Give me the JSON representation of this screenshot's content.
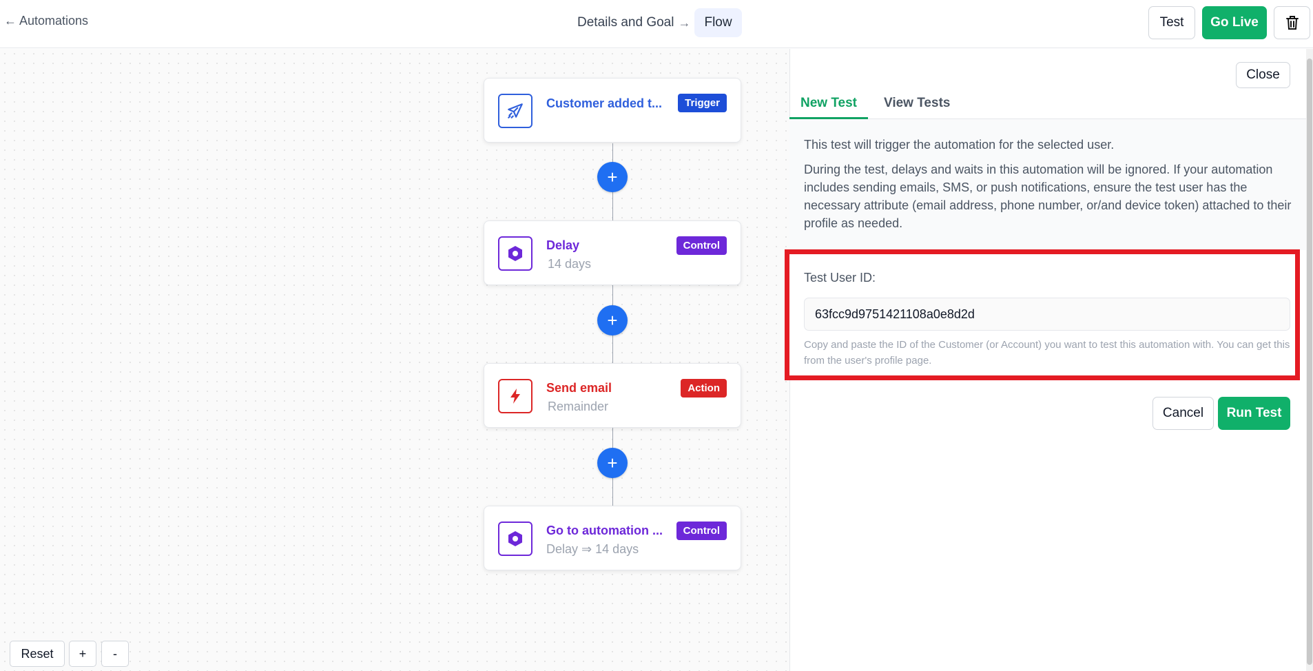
{
  "header": {
    "back_label": "Automations",
    "crumb_details": "Details and Goal",
    "crumb_flow": "Flow",
    "test_label": "Test",
    "go_live_label": "Go Live"
  },
  "flow": {
    "nodes": [
      {
        "title": "Customer added t...",
        "subtitle": "",
        "badge": "Trigger",
        "icon": "paper-plane-icon",
        "color": "#2f5fdc",
        "badge_color": "#1d4ed8"
      },
      {
        "title": "Delay",
        "subtitle": "14 days",
        "badge": "Control",
        "icon": "hexagon-icon",
        "color": "#6d28d9",
        "badge_color": "#6d28d9"
      },
      {
        "title": "Send email",
        "subtitle": "Remainder",
        "badge": "Action",
        "icon": "lightning-icon",
        "color": "#dc2626",
        "badge_color": "#dc2626"
      },
      {
        "title": "Go to automation ...",
        "subtitle": "Delay ⇒ 14 days",
        "badge": "Control",
        "icon": "hexagon-icon",
        "color": "#6d28d9",
        "badge_color": "#6d28d9"
      }
    ],
    "add_step_symbol": "+"
  },
  "zoom": {
    "reset_label": "Reset",
    "zoom_in_label": "+",
    "zoom_out_label": "-"
  },
  "panel": {
    "close_label": "Close",
    "tabs": [
      {
        "label": "New Test",
        "active": true
      },
      {
        "label": "View Tests",
        "active": false
      }
    ],
    "desc_line1": "This test will trigger the automation for the selected user.",
    "desc_line2": "During the test, delays and waits in this automation will be ignored. If your automation includes sending emails, SMS, or push notifications, ensure the test user has the necessary attribute (email address, phone number, or/and device token) attached to their profile as needed.",
    "user_id_label": "Test User ID:",
    "user_id_value": "63fcc9d9751421108a0e8d2d",
    "user_id_help": "Copy and paste the ID of the Customer (or Account) you want to test this automation with. You can get this from the user's profile page.",
    "cancel_label": "Cancel",
    "run_label": "Run Test"
  },
  "colors": {
    "accent_green": "#10b06a",
    "primary_blue": "#1f6ff2",
    "highlight_red": "#e41b23"
  }
}
